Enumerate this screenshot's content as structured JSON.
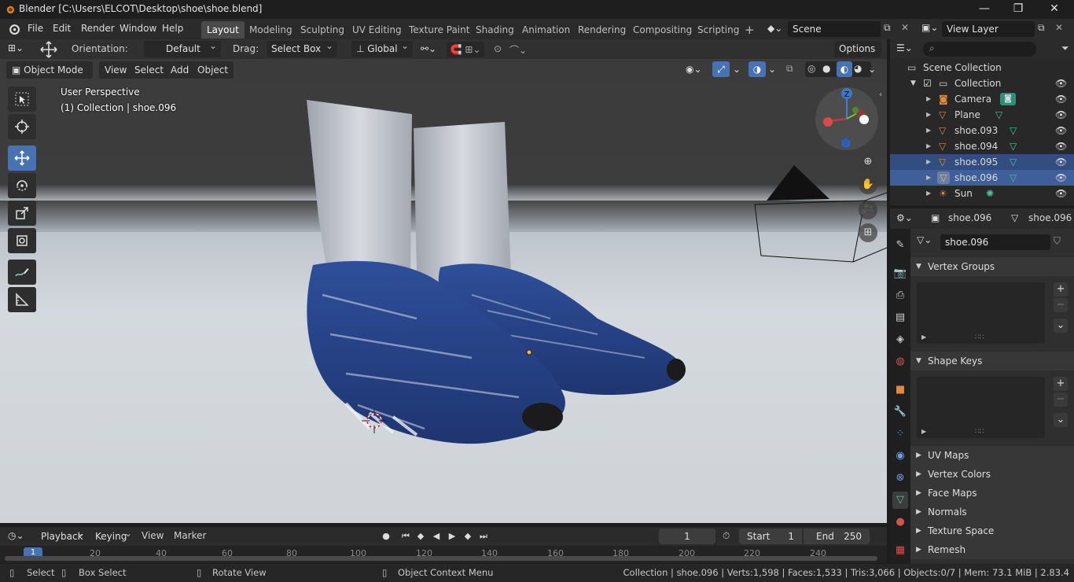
{
  "window": {
    "title": "Blender [C:\\Users\\ELCOT\\Desktop\\shoe\\shoe.blend]",
    "minimize": "—",
    "maximize": "❐",
    "close": "✕"
  },
  "menu": {
    "file": "File",
    "edit": "Edit",
    "render": "Render",
    "window": "Window",
    "help": "Help"
  },
  "workspaces": [
    "Layout",
    "Modeling",
    "Sculpting",
    "UV Editing",
    "Texture Paint",
    "Shading",
    "Animation",
    "Rendering",
    "Compositing",
    "Scripting"
  ],
  "active_workspace": "Layout",
  "add_workspace": "+",
  "scene": {
    "name": "Scene",
    "view_layer": "View Layer"
  },
  "viewport_header": {
    "orientation_label": "Orientation:",
    "orientation_value": "Default",
    "drag_label": "Drag:",
    "drag_value": "Select Box",
    "transform_orientation": "Global",
    "options": "Options"
  },
  "viewport_menu": {
    "mode": "Object Mode",
    "view": "View",
    "select": "Select",
    "add": "Add",
    "object": "Object"
  },
  "viewport_overlay": {
    "perspective": "User Perspective",
    "context": "(1) Collection | shoe.096"
  },
  "gizmo": {
    "z": "Z"
  },
  "timeline": {
    "playback": "Playback",
    "keying": "Keying",
    "view": "View",
    "marker": "Marker",
    "current_frame": "1",
    "start_label": "Start",
    "start_value": "1",
    "end_label": "End",
    "end_value": "250",
    "ticks": [
      "1",
      "20",
      "40",
      "60",
      "80",
      "100",
      "120",
      "140",
      "160",
      "180",
      "200",
      "220",
      "240"
    ]
  },
  "statusbar": {
    "select": "Select",
    "box_select": "Box Select",
    "rotate_view": "Rotate View",
    "context_menu": "Object Context Menu",
    "stats": "Collection | shoe.096 | Verts:1,598 | Faces:1,533 | Tris:3,066 | Objects:0/7 | Mem: 73.1 MiB | 2.83.4"
  },
  "outliner": {
    "root": "Scene Collection",
    "collection": "Collection",
    "items": [
      {
        "name": "Camera",
        "icon": "camera-icon"
      },
      {
        "name": "Plane",
        "icon": "mesh-icon"
      },
      {
        "name": "shoe.093",
        "icon": "mesh-icon"
      },
      {
        "name": "shoe.094",
        "icon": "mesh-icon"
      },
      {
        "name": "shoe.095",
        "icon": "mesh-icon"
      },
      {
        "name": "shoe.096",
        "icon": "mesh-icon"
      },
      {
        "name": "Sun",
        "icon": "light-icon"
      }
    ]
  },
  "properties": {
    "object_name": "shoe.096",
    "mesh_name": "shoe.096",
    "data_field": "shoe.096",
    "panels": {
      "vertex_groups": "Vertex Groups",
      "shape_keys": "Shape Keys",
      "uv_maps": "UV Maps",
      "vertex_colors": "Vertex Colors",
      "face_maps": "Face Maps",
      "normals": "Normals",
      "texture_space": "Texture Space",
      "remesh": "Remesh"
    }
  },
  "colors": {
    "accent": "#4772b3",
    "selection": "#334d80",
    "mesh_icon": "#e08a3c",
    "data_icon": "#4fc3a1"
  }
}
